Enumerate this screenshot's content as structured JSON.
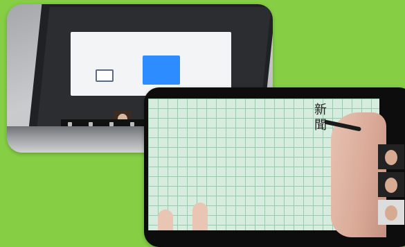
{
  "laptop_photo": {
    "subject": "laptop-screen-share-dialog",
    "accent_color": "#2d8cff"
  },
  "notebook_photo": {
    "subject": "grid-notebook-writing",
    "handwritten_text": "新聞"
  },
  "colors": {
    "background": "#86cf45",
    "paper": "#d7ebde",
    "grid_line": "#9ec7b0"
  }
}
